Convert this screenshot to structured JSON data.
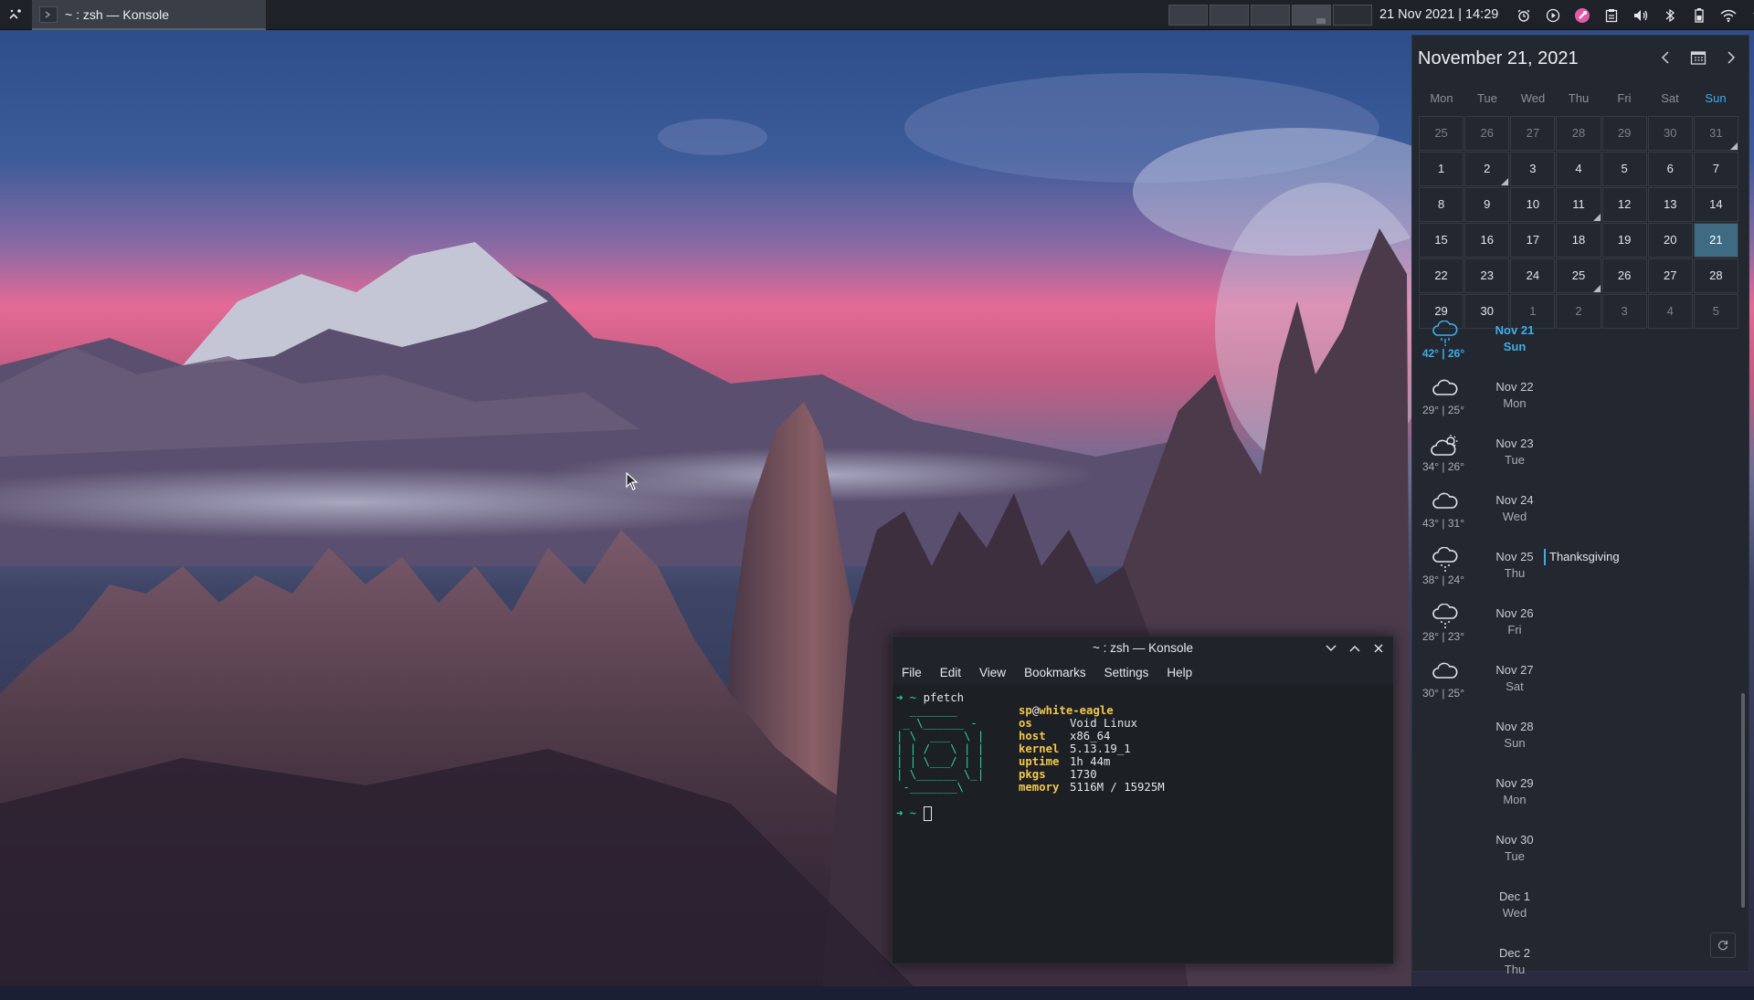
{
  "taskbar": {
    "window_title": "~ : zsh — Konsole",
    "clock": "21 Nov 2021 | 14:29",
    "tray_icons": [
      "alarm-icon",
      "media-play-icon",
      "color-picker-icon",
      "clipboard-icon",
      "volume-icon",
      "bluetooth-icon",
      "battery-icon",
      "wifi-icon",
      "expand-tray-icon"
    ]
  },
  "calendar": {
    "title": "November 21, 2021",
    "weekdays": [
      "Mon",
      "Tue",
      "Wed",
      "Thu",
      "Fri",
      "Sat",
      "Sun"
    ],
    "weeks": [
      [
        "25",
        "26",
        "27",
        "28",
        "29",
        "30",
        "31"
      ],
      [
        "1",
        "2",
        "3",
        "4",
        "5",
        "6",
        "7"
      ],
      [
        "8",
        "9",
        "10",
        "11",
        "12",
        "13",
        "14"
      ],
      [
        "15",
        "16",
        "17",
        "18",
        "19",
        "20",
        "21"
      ],
      [
        "22",
        "23",
        "24",
        "25",
        "26",
        "27",
        "28"
      ],
      [
        "29",
        "30",
        "1",
        "2",
        "3",
        "4",
        "5"
      ]
    ],
    "today": "21",
    "agenda": [
      {
        "date": "Nov 21",
        "day": "Sun",
        "temp": "42° | 26°",
        "weather": "rain-cloud-icon",
        "today": true
      },
      {
        "date": "Nov 22",
        "day": "Mon",
        "temp": "29° | 25°",
        "weather": "cloud-icon"
      },
      {
        "date": "Nov 23",
        "day": "Tue",
        "temp": "34° | 26°",
        "weather": "partly-sunny-icon"
      },
      {
        "date": "Nov 24",
        "day": "Wed",
        "temp": "43° | 31°",
        "weather": "cloud-icon"
      },
      {
        "date": "Nov 25",
        "day": "Thu",
        "temp": "38° | 24°",
        "weather": "snow-cloud-icon",
        "event": "Thanksgiving"
      },
      {
        "date": "Nov 26",
        "day": "Fri",
        "temp": "28° | 23°",
        "weather": "snow-cloud-icon"
      },
      {
        "date": "Nov 27",
        "day": "Sat",
        "temp": "30° | 25°",
        "weather": "cloud-icon"
      },
      {
        "date": "Nov 28",
        "day": "Sun"
      },
      {
        "date": "Nov 29",
        "day": "Mon"
      },
      {
        "date": "Nov 30",
        "day": "Tue"
      },
      {
        "date": "Dec 1",
        "day": "Wed"
      },
      {
        "date": "Dec 2",
        "day": "Thu"
      }
    ]
  },
  "konsole": {
    "title": "~ : zsh — Konsole",
    "menu": [
      "File",
      "Edit",
      "View",
      "Bookmarks",
      "Settings",
      "Help"
    ],
    "prompt_symbol": "➜ ~",
    "command": "pfetch",
    "logo": [
      "  _______",
      " _ \\______ -",
      "| \\  ___  \\ |",
      "| | /   \\ | |",
      "| | \\___/ | |",
      "| \\______ \\_|",
      " -_______\\"
    ],
    "user": "sp",
    "host_name": "white-eagle",
    "info": [
      {
        "key": "os",
        "value": "Void Linux"
      },
      {
        "key": "host",
        "value": "x86_64"
      },
      {
        "key": "kernel",
        "value": "5.13.19_1"
      },
      {
        "key": "uptime",
        "value": "1h 44m"
      },
      {
        "key": "pkgs",
        "value": "1730"
      },
      {
        "key": "memory",
        "value": "5116M / 15925M"
      }
    ]
  }
}
